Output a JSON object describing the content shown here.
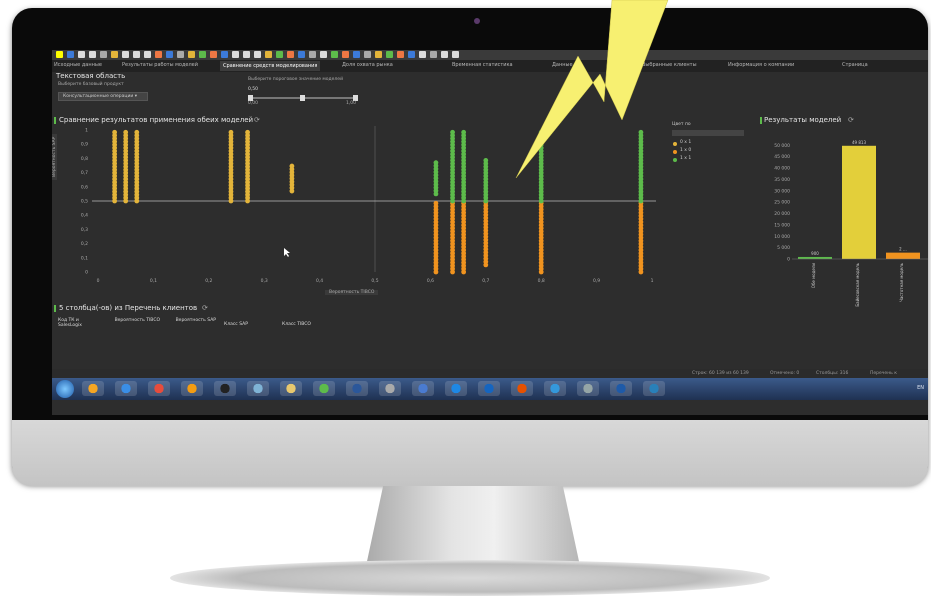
{
  "toolbar": {
    "icons": [
      "yellow",
      "#3c7ad8",
      "#ddd",
      "#ddd",
      "#aaa",
      "#e3b43a",
      "#ddd",
      "#ddd",
      "#ddd",
      "#e74",
      "#3c7ad8",
      "#aaa",
      "#e3b43a",
      "#5dbb4b",
      "#e74",
      "#3c7ad8",
      "#ddd",
      "#ddd",
      "#ddd",
      "#e3b43a",
      "#5dbb4b",
      "#e74",
      "#3c7ad8",
      "#aaa",
      "#ddd",
      "#5dbb4b",
      "#e74",
      "#3c7ad8",
      "#aaa",
      "#e3b43a",
      "#5dbb4b",
      "#e74",
      "#3c7ad8",
      "#ddd",
      "#aaa",
      "#ddd",
      "#ddd"
    ]
  },
  "tabs": [
    {
      "label": "Исходные данные"
    },
    {
      "label": "Результаты работы моделей"
    },
    {
      "label": "Сравнение средств моделирования"
    },
    {
      "label": "Доля охвата рынка"
    },
    {
      "label": "Временная статистика"
    },
    {
      "label": "Данные"
    },
    {
      "label": "Выбранные клиенты"
    },
    {
      "label": "Информация о компании"
    },
    {
      "label": "Страница"
    }
  ],
  "text_area": {
    "title": "Текстовая область",
    "product_label": "Выберите базовый продукт",
    "product_value": "Консультационные операции",
    "threshold_label": "Выберите пороговое значение моделей",
    "threshold_value": "0,50",
    "slider_min": "0,00",
    "slider_max": "1,00"
  },
  "comparison": {
    "title": "Сравнение результатов применения обеих моделей",
    "x_axis_selector": "Вероятность TIBCO",
    "y_axis_selector": "Вероятность SAP",
    "legend_title": "Цвет по",
    "legend_items": [
      {
        "label": "0 x 1",
        "color": "#e3b43a"
      },
      {
        "label": "1 x 0",
        "color": "#f0931f"
      },
      {
        "label": "1 x 1",
        "color": "#5dbb4b"
      }
    ],
    "y_ticks": [
      "1",
      "0,9",
      "0,8",
      "0,7",
      "0,6",
      "0,5",
      "0,4",
      "0,3",
      "0,2",
      "0,1",
      "0"
    ],
    "x_ticks": [
      "0",
      "0,1",
      "0,2",
      "0,3",
      "0,4",
      "0,5",
      "0,6",
      "0,7",
      "0,8",
      "0,9",
      "1"
    ]
  },
  "chart_data": [
    {
      "type": "scatter",
      "title": "Сравнение результатов применения обеих моделей",
      "xlabel": "Вероятность TIBCO",
      "ylabel": "Вероятность SAP",
      "xlim": [
        0,
        1
      ],
      "ylim": [
        0,
        1
      ],
      "threshold": 0.5,
      "series": [
        {
          "name": "0 x 1",
          "color": "#e3b43a",
          "columns": [
            {
              "x": 0.03,
              "ymin": 0.5,
              "ymax": 1.0
            },
            {
              "x": 0.05,
              "ymin": 0.5,
              "ymax": 1.0
            },
            {
              "x": 0.07,
              "ymin": 0.5,
              "ymax": 1.0
            },
            {
              "x": 0.24,
              "ymin": 0.5,
              "ymax": 1.0
            },
            {
              "x": 0.27,
              "ymin": 0.5,
              "ymax": 1.0
            },
            {
              "x": 0.35,
              "ymin": 0.57,
              "ymax": 0.75
            }
          ]
        },
        {
          "name": "1 x 0",
          "color": "#f0931f",
          "columns": [
            {
              "x": 0.61,
              "ymin": 0.0,
              "ymax": 0.5
            },
            {
              "x": 0.64,
              "ymin": 0.0,
              "ymax": 0.5
            },
            {
              "x": 0.66,
              "ymin": 0.0,
              "ymax": 0.5
            },
            {
              "x": 0.7,
              "ymin": 0.05,
              "ymax": 0.5
            },
            {
              "x": 0.8,
              "ymin": 0.0,
              "ymax": 0.5
            },
            {
              "x": 0.98,
              "ymin": 0.0,
              "ymax": 0.5
            }
          ]
        },
        {
          "name": "1 x 1",
          "color": "#5dbb4b",
          "columns": [
            {
              "x": 0.61,
              "ymin": 0.55,
              "ymax": 0.78
            },
            {
              "x": 0.64,
              "ymin": 0.5,
              "ymax": 1.0
            },
            {
              "x": 0.66,
              "ymin": 0.5,
              "ymax": 1.0
            },
            {
              "x": 0.7,
              "ymin": 0.5,
              "ymax": 0.8
            },
            {
              "x": 0.8,
              "ymin": 0.5,
              "ymax": 1.0
            },
            {
              "x": 0.98,
              "ymin": 0.5,
              "ymax": 1.0
            }
          ]
        }
      ]
    },
    {
      "type": "bar",
      "title": "Результаты моделей",
      "categories": [
        "Обе модели",
        "Байесовская модель",
        "Частотная модель"
      ],
      "values": [
        900,
        49813,
        2800
      ],
      "colors": [
        "#5dbb4b",
        "#e3cf3a",
        "#f0931f"
      ],
      "data_labels": [
        "900",
        "49 813",
        "2 ..."
      ],
      "ylim": [
        0,
        55000
      ],
      "y_ticks": [
        "50 000",
        "45 000",
        "40 000",
        "35 000",
        "30 000",
        "25 000",
        "20 000",
        "15 000",
        "10 000",
        "5 000",
        "0"
      ]
    }
  ],
  "results": {
    "title": "Результаты моделей"
  },
  "list_section": {
    "title": "5 столбца(-ов) из Перечень клиентов",
    "columns": [
      "Код ТК и SalesLogix",
      "Вероятность TIBCO",
      "Вероятность SAP",
      "Класс SAP",
      "Класс TIBCO"
    ]
  },
  "status": {
    "rows": "Строк: 60 139 из 60 139",
    "marked": "Отмечено: 0",
    "columns": "Столбцы: 316",
    "filter": "Перечень к"
  },
  "taskbar": {
    "apps": [
      "#f6a623",
      "#3a8ee6",
      "#e74c3c",
      "#f39c12",
      "#222",
      "#7fb3d5",
      "#e8c86e",
      "#5dbb4b",
      "#2b579a",
      "#aaa",
      "#4a7bd0",
      "#1e88e5",
      "#1565c0",
      "#e65100",
      "#3498db",
      "#95a5a6",
      "#1e5aa8",
      "#2980b9"
    ],
    "tray_text": "EN"
  }
}
